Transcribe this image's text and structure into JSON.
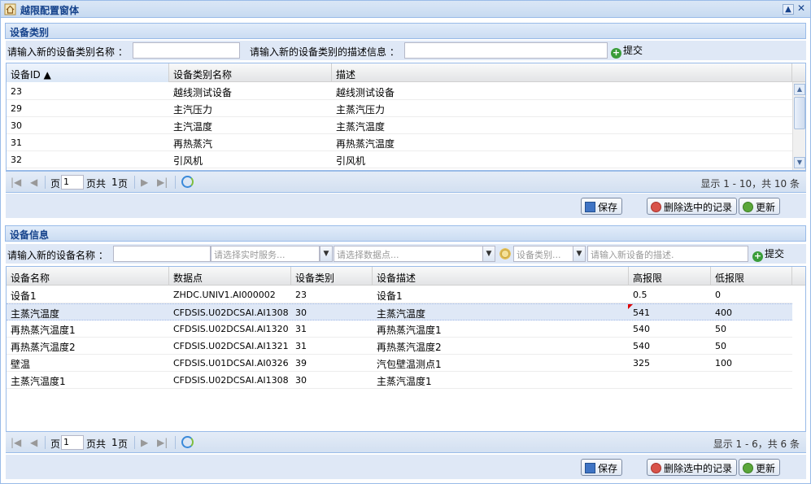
{
  "window": {
    "title": "越限配置窗体",
    "collapse_icon": "▲",
    "close_icon": "✕"
  },
  "category_section": {
    "title": "设备类别",
    "form": {
      "name_label": "请输入新的设备类别名称 ：",
      "name_value": "",
      "desc_label": "请输入新的设备类别的描述信息 ：",
      "desc_value": "",
      "submit_label": "提交"
    },
    "grid": {
      "columns": [
        "设备ID ▲",
        "设备类别名称",
        "描述"
      ],
      "rows": [
        [
          "23",
          "越线测试设备",
          "越线测试设备"
        ],
        [
          "29",
          "主汽压力",
          "主蒸汽压力"
        ],
        [
          "30",
          "主汽温度",
          "主蒸汽温度"
        ],
        [
          "31",
          "再热蒸汽",
          "再热蒸汽温度"
        ],
        [
          "32",
          "引风机",
          "引风机"
        ]
      ]
    },
    "pager": {
      "page_label": "页",
      "page_value": "1",
      "of_label": "页共",
      "total_pages": "1",
      "page_suffix": "页",
      "info": "显示 1 - 10，共 10 条"
    },
    "buttons": {
      "save": "保存",
      "delete": "删除选中的记录",
      "update": "更新"
    }
  },
  "device_section": {
    "title": "设备信息",
    "form": {
      "name_label": "请输入新的设备名称 ：",
      "name_value": "",
      "service_placeholder": "请选择实时服务...",
      "point_placeholder": "请选择数据点...",
      "category_placeholder": "设备类别...",
      "desc_placeholder": "请输入新设备的描述.",
      "submit_label": "提交"
    },
    "grid": {
      "columns": [
        "设备名称",
        "数据点",
        "设备类别",
        "设备描述",
        "高报限",
        "低报限"
      ],
      "rows": [
        [
          "设备1",
          "ZHDC.UNIV1.AI000002",
          "23",
          "设备1",
          "0.5",
          "0"
        ],
        [
          "主蒸汽温度",
          "CFDSIS.U02DCSAI.AI1308",
          "30",
          "主蒸汽温度",
          "541",
          "400"
        ],
        [
          "再热蒸汽温度1",
          "CFDSIS.U02DCSAI.AI1320",
          "31",
          "再热蒸汽温度1",
          "540",
          "50"
        ],
        [
          "再热蒸汽温度2",
          "CFDSIS.U02DCSAI.AI1321",
          "31",
          "再热蒸汽温度2",
          "540",
          "50"
        ],
        [
          "壁温",
          "CFDSIS.U01DCSAI.AI0326",
          "39",
          "汽包壁温测点1",
          "325",
          "100"
        ],
        [
          "主蒸汽温度1",
          "CFDSIS.U02DCSAI.AI1308",
          "30",
          "主蒸汽温度1",
          "",
          ""
        ]
      ],
      "selected_row": 1
    },
    "pager": {
      "page_label": "页",
      "page_value": "1",
      "of_label": "页共",
      "total_pages": "1",
      "page_suffix": "页",
      "info": "显示 1 - 6，共 6 条"
    },
    "buttons": {
      "save": "保存",
      "delete": "删除选中的记录",
      "update": "更新"
    }
  }
}
